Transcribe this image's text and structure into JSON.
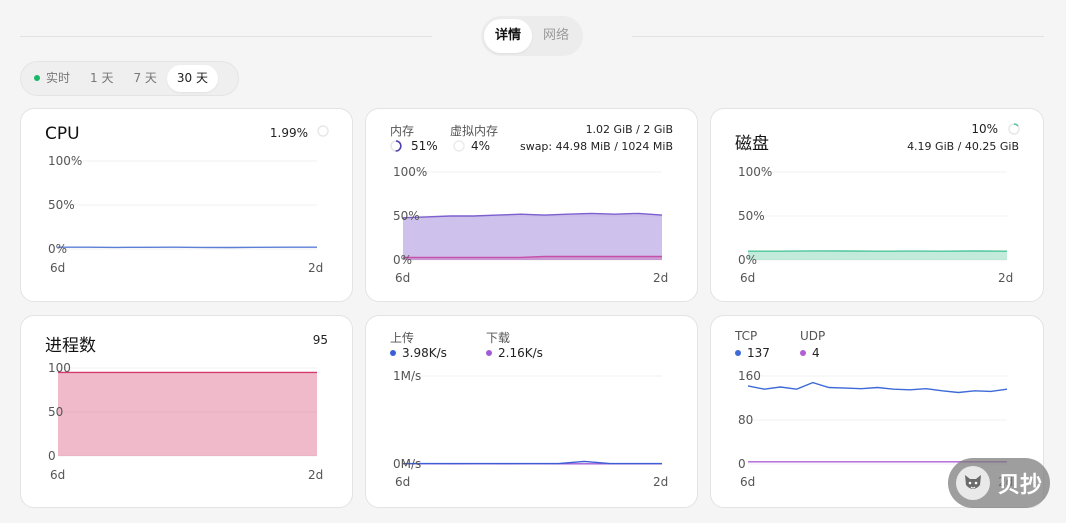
{
  "header": {
    "tabs": [
      {
        "label": "详情",
        "active": true
      },
      {
        "label": "网络",
        "active": false
      }
    ]
  },
  "range_tabs": [
    {
      "label": "实时",
      "live": true,
      "active": false
    },
    {
      "label": "1 天",
      "active": false
    },
    {
      "label": "7 天",
      "active": false
    },
    {
      "label": "30 天",
      "active": true
    }
  ],
  "cards": {
    "cpu": {
      "title": "CPU",
      "value": "1.99%",
      "y_ticks": [
        "100%",
        "50%",
        "0%"
      ],
      "x_start": "6d",
      "x_end": "2d"
    },
    "memory": {
      "mem_label": "内存",
      "mem_pct": "51%",
      "swap_label": "虚拟内存",
      "swap_pct": "4%",
      "mem_detail": "1.02 GiB / 2 GiB",
      "swap_detail": "swap: 44.98 MiB / 1024 MiB",
      "y_ticks": [
        "100%",
        "50%",
        "0%"
      ],
      "x_start": "6d",
      "x_end": "2d"
    },
    "disk": {
      "title": "磁盘",
      "value": "10%",
      "detail": "4.19 GiB / 40.25 GiB",
      "y_ticks": [
        "100%",
        "50%",
        "0%"
      ],
      "x_start": "6d",
      "x_end": "2d"
    },
    "process": {
      "title": "进程数",
      "value": "95",
      "y_ticks": [
        "100",
        "50",
        "0"
      ],
      "x_start": "6d",
      "x_end": "2d"
    },
    "network": {
      "up_label": "上传",
      "up_value": "3.98K/s",
      "down_label": "下载",
      "down_value": "2.16K/s",
      "y_ticks": [
        "1M/s",
        "0M/s"
      ],
      "x_start": "6d",
      "x_end": "2d"
    },
    "connections": {
      "tcp_label": "TCP",
      "tcp_value": "137",
      "udp_label": "UDP",
      "udp_value": "4",
      "y_ticks": [
        "160",
        "80",
        "0"
      ],
      "x_start": "6d",
      "x_end": "2d"
    }
  },
  "colors": {
    "cpu": "#5b7fd6",
    "memory": "#7d5fd0",
    "swap": "#c64fa8",
    "disk": "#4fc59a",
    "process": "#d43a6a",
    "upload": "#3d5fd6",
    "download": "#a35bd6",
    "tcp": "#3d6ad6",
    "udp": "#b15fd6"
  },
  "watermark": {
    "text": "贝抄",
    "icon": "dog-icon"
  },
  "chart_data": [
    {
      "type": "line",
      "series": [
        {
          "name": "CPU",
          "values": [
            2,
            2,
            1.8,
            1.9,
            2,
            1.8,
            1.7,
            1.9,
            2,
            1.99
          ]
        }
      ],
      "ylim": [
        0,
        100
      ]
    },
    {
      "type": "area",
      "series": [
        {
          "name": "内存",
          "values": [
            48,
            49,
            50,
            50,
            51,
            52,
            51,
            52,
            53,
            52,
            53,
            51
          ]
        },
        {
          "name": "虚拟内存",
          "values": [
            3,
            3,
            3,
            3,
            3,
            3,
            4,
            4,
            4,
            4,
            4,
            4
          ]
        }
      ],
      "ylim": [
        0,
        100
      ]
    },
    {
      "type": "area",
      "series": [
        {
          "name": "磁盘",
          "values": [
            10,
            10,
            10.3,
            10.2,
            10,
            10.1,
            10,
            10.2,
            10
          ]
        }
      ],
      "ylim": [
        0,
        100
      ]
    },
    {
      "type": "area",
      "series": [
        {
          "name": "进程数",
          "values": [
            95,
            95,
            95,
            95,
            95,
            95,
            95,
            95,
            95
          ]
        }
      ],
      "ylim": [
        0,
        100
      ]
    },
    {
      "type": "line",
      "series": [
        {
          "name": "上传",
          "values": [
            0.005,
            0.005,
            0.004,
            0.005,
            0.004,
            0.005,
            0.004,
            0.03,
            0.004,
            0.004,
            0.004
          ]
        },
        {
          "name": "下载",
          "values": [
            0.003,
            0.003,
            0.002,
            0.003,
            0.002,
            0.003,
            0.002,
            0.002,
            0.002,
            0.002,
            0.002
          ]
        }
      ],
      "ylim": [
        0,
        1
      ]
    },
    {
      "type": "line",
      "series": [
        {
          "name": "TCP",
          "values": [
            142,
            136,
            140,
            136,
            148,
            139,
            138,
            137,
            139,
            136,
            135,
            137,
            133,
            130,
            133,
            132,
            136
          ]
        },
        {
          "name": "UDP",
          "values": [
            4,
            4,
            4,
            4,
            4,
            4,
            4,
            4,
            4,
            4,
            4,
            4,
            4,
            4,
            4,
            4,
            4
          ]
        }
      ],
      "ylim": [
        0,
        160
      ]
    }
  ]
}
